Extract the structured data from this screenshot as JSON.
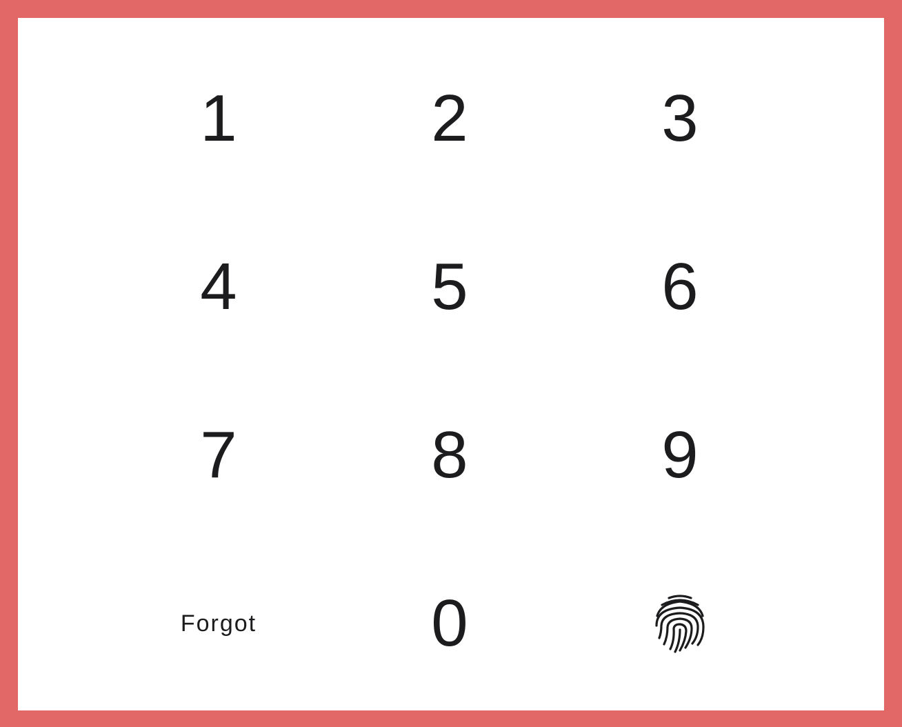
{
  "colors": {
    "frame": "#e26767",
    "panel": "#ffffff",
    "text": "#1c1c1e"
  },
  "keypad": {
    "keys": [
      {
        "label": "1"
      },
      {
        "label": "2"
      },
      {
        "label": "3"
      },
      {
        "label": "4"
      },
      {
        "label": "5"
      },
      {
        "label": "6"
      },
      {
        "label": "7"
      },
      {
        "label": "8"
      },
      {
        "label": "9"
      },
      {
        "label": "0"
      }
    ],
    "forgot_label": "Forgot",
    "fingerprint_icon": "fingerprint-icon"
  }
}
